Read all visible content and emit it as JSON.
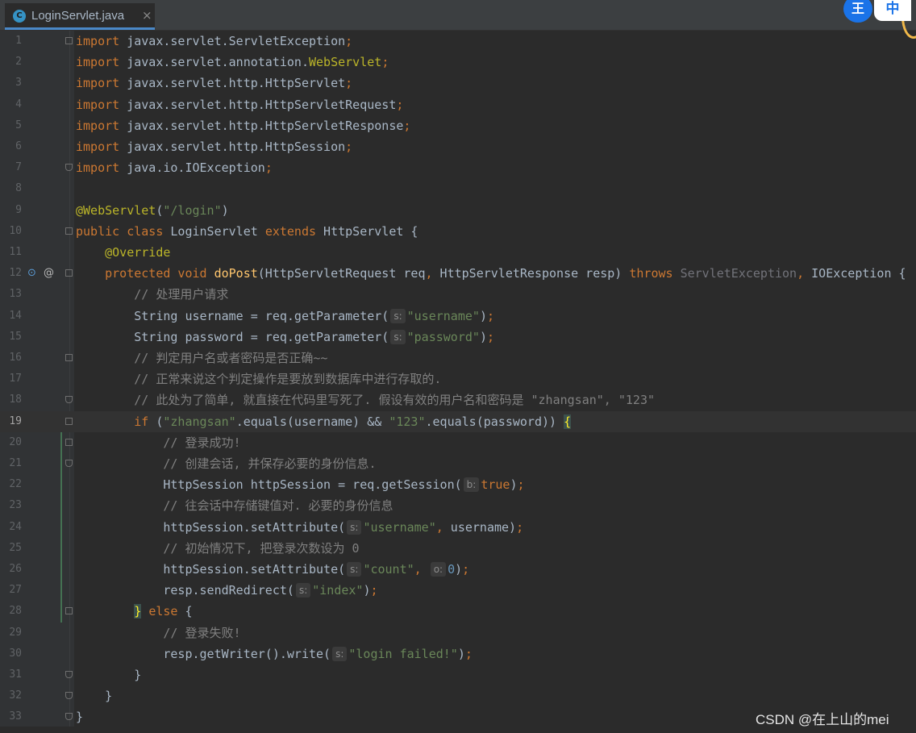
{
  "tab": {
    "title": "LoginServlet.java",
    "icon_letter": "C",
    "close": "×"
  },
  "ime": {
    "badge": "王",
    "lang": "中"
  },
  "editor": {
    "current_line": 19,
    "lines": [
      {
        "n": "1",
        "html": "<span class=\"kw\">import</span> javax.servlet.ServletException<span class=\"kw\">;</span>"
      },
      {
        "n": "2",
        "html": "<span class=\"kw\">import</span> javax.servlet.annotation.<span class=\"ann\">WebServlet</span><span class=\"kw\">;</span>"
      },
      {
        "n": "3",
        "html": "<span class=\"kw\">import</span> javax.servlet.http.HttpServlet<span class=\"kw\">;</span>"
      },
      {
        "n": "4",
        "html": "<span class=\"kw\">import</span> javax.servlet.http.HttpServletRequest<span class=\"kw\">;</span>"
      },
      {
        "n": "5",
        "html": "<span class=\"kw\">import</span> javax.servlet.http.HttpServletResponse<span class=\"kw\">;</span>"
      },
      {
        "n": "6",
        "html": "<span class=\"kw\">import</span> javax.servlet.http.HttpSession<span class=\"kw\">;</span>"
      },
      {
        "n": "7",
        "html": "<span class=\"kw\">import</span> java.io.IOException<span class=\"kw\">;</span>"
      },
      {
        "n": "8",
        "html": ""
      },
      {
        "n": "9",
        "html": "<span class=\"ann\">@WebServlet</span>(<span class=\"str\">\"/login\"</span>)"
      },
      {
        "n": "10",
        "html": "<span class=\"kw\">public class</span> LoginServlet <span class=\"kw\">extends</span> HttpServlet {"
      },
      {
        "n": "11",
        "html": "    <span class=\"ann\">@Override</span>"
      },
      {
        "n": "12",
        "html": "    <span class=\"kw\">protected void</span> <span class=\"mth\">doPost</span>(HttpServletRequest req<span class=\"kw\">,</span> HttpServletResponse resp) <span class=\"kw\">throws</span> <span class=\"gray\">ServletException</span><span class=\"kw\">,</span> IOException {"
      },
      {
        "n": "13",
        "html": "        <span class=\"cm\">// 处理用户请求</span>"
      },
      {
        "n": "14",
        "html": "        String username = req.getParameter(<span class=\"hint\">s:</span><span class=\"str\">\"username\"</span>)<span class=\"kw\">;</span>"
      },
      {
        "n": "15",
        "html": "        String password = req.getParameter(<span class=\"hint\">s:</span><span class=\"str\">\"password\"</span>)<span class=\"kw\">;</span>"
      },
      {
        "n": "16",
        "html": "        <span class=\"cm\">// 判定用户名或者密码是否正确~~</span>"
      },
      {
        "n": "17",
        "html": "        <span class=\"cm\">// 正常来说这个判定操作是要放到数据库中进行存取的.</span>"
      },
      {
        "n": "18",
        "html": "        <span class=\"cm\">// 此处为了简单, 就直接在代码里写死了. 假设有效的用户名和密码是 \"zhangsan\", \"123\"</span>"
      },
      {
        "n": "19",
        "html": "        <span class=\"kw\">if</span> (<span class=\"str\">\"zhangsan\"</span>.equals(username) &amp;&amp; <span class=\"str\">\"123\"</span>.equals(password)) <span class=\"brace\">{</span>"
      },
      {
        "n": "20",
        "html": "            <span class=\"cm\">// 登录成功!</span>"
      },
      {
        "n": "21",
        "html": "            <span class=\"cm\">// 创建会话, 并保存必要的身份信息.</span>"
      },
      {
        "n": "22",
        "html": "            HttpSession httpSession = req.getSession(<span class=\"hint\">b:</span><span class=\"kw\">true</span>)<span class=\"kw\">;</span>"
      },
      {
        "n": "23",
        "html": "            <span class=\"cm\">// 往会话中存储键值对. 必要的身份信息</span>"
      },
      {
        "n": "24",
        "html": "            httpSession.setAttribute(<span class=\"hint\">s:</span><span class=\"str\">\"username\"</span><span class=\"kw\">,</span> username)<span class=\"kw\">;</span>"
      },
      {
        "n": "25",
        "html": "            <span class=\"cm\">// 初始情况下, 把登录次数设为 0</span>"
      },
      {
        "n": "26",
        "html": "            httpSession.setAttribute(<span class=\"hint\">s:</span><span class=\"str\">\"count\"</span><span class=\"kw\">,</span> <span class=\"hint\">o:</span><span class=\"num\">0</span>)<span class=\"kw\">;</span>"
      },
      {
        "n": "27",
        "html": "            resp.sendRedirect(<span class=\"hint\">s:</span><span class=\"str\">\"index\"</span>)<span class=\"kw\">;</span>"
      },
      {
        "n": "28",
        "html": "        <span class=\"brace\">}</span> <span class=\"kw\">else</span> {"
      },
      {
        "n": "29",
        "html": "            <span class=\"cm\">// 登录失败!</span>"
      },
      {
        "n": "30",
        "html": "            resp.getWriter().write(<span class=\"hint\">s:</span><span class=\"str\">\"login failed!\"</span>)<span class=\"kw\">;</span>"
      },
      {
        "n": "31",
        "html": "        }"
      },
      {
        "n": "32",
        "html": "    }"
      },
      {
        "n": "33",
        "html": "}"
      }
    ]
  },
  "watermark": "CSDN @在上山的mei"
}
